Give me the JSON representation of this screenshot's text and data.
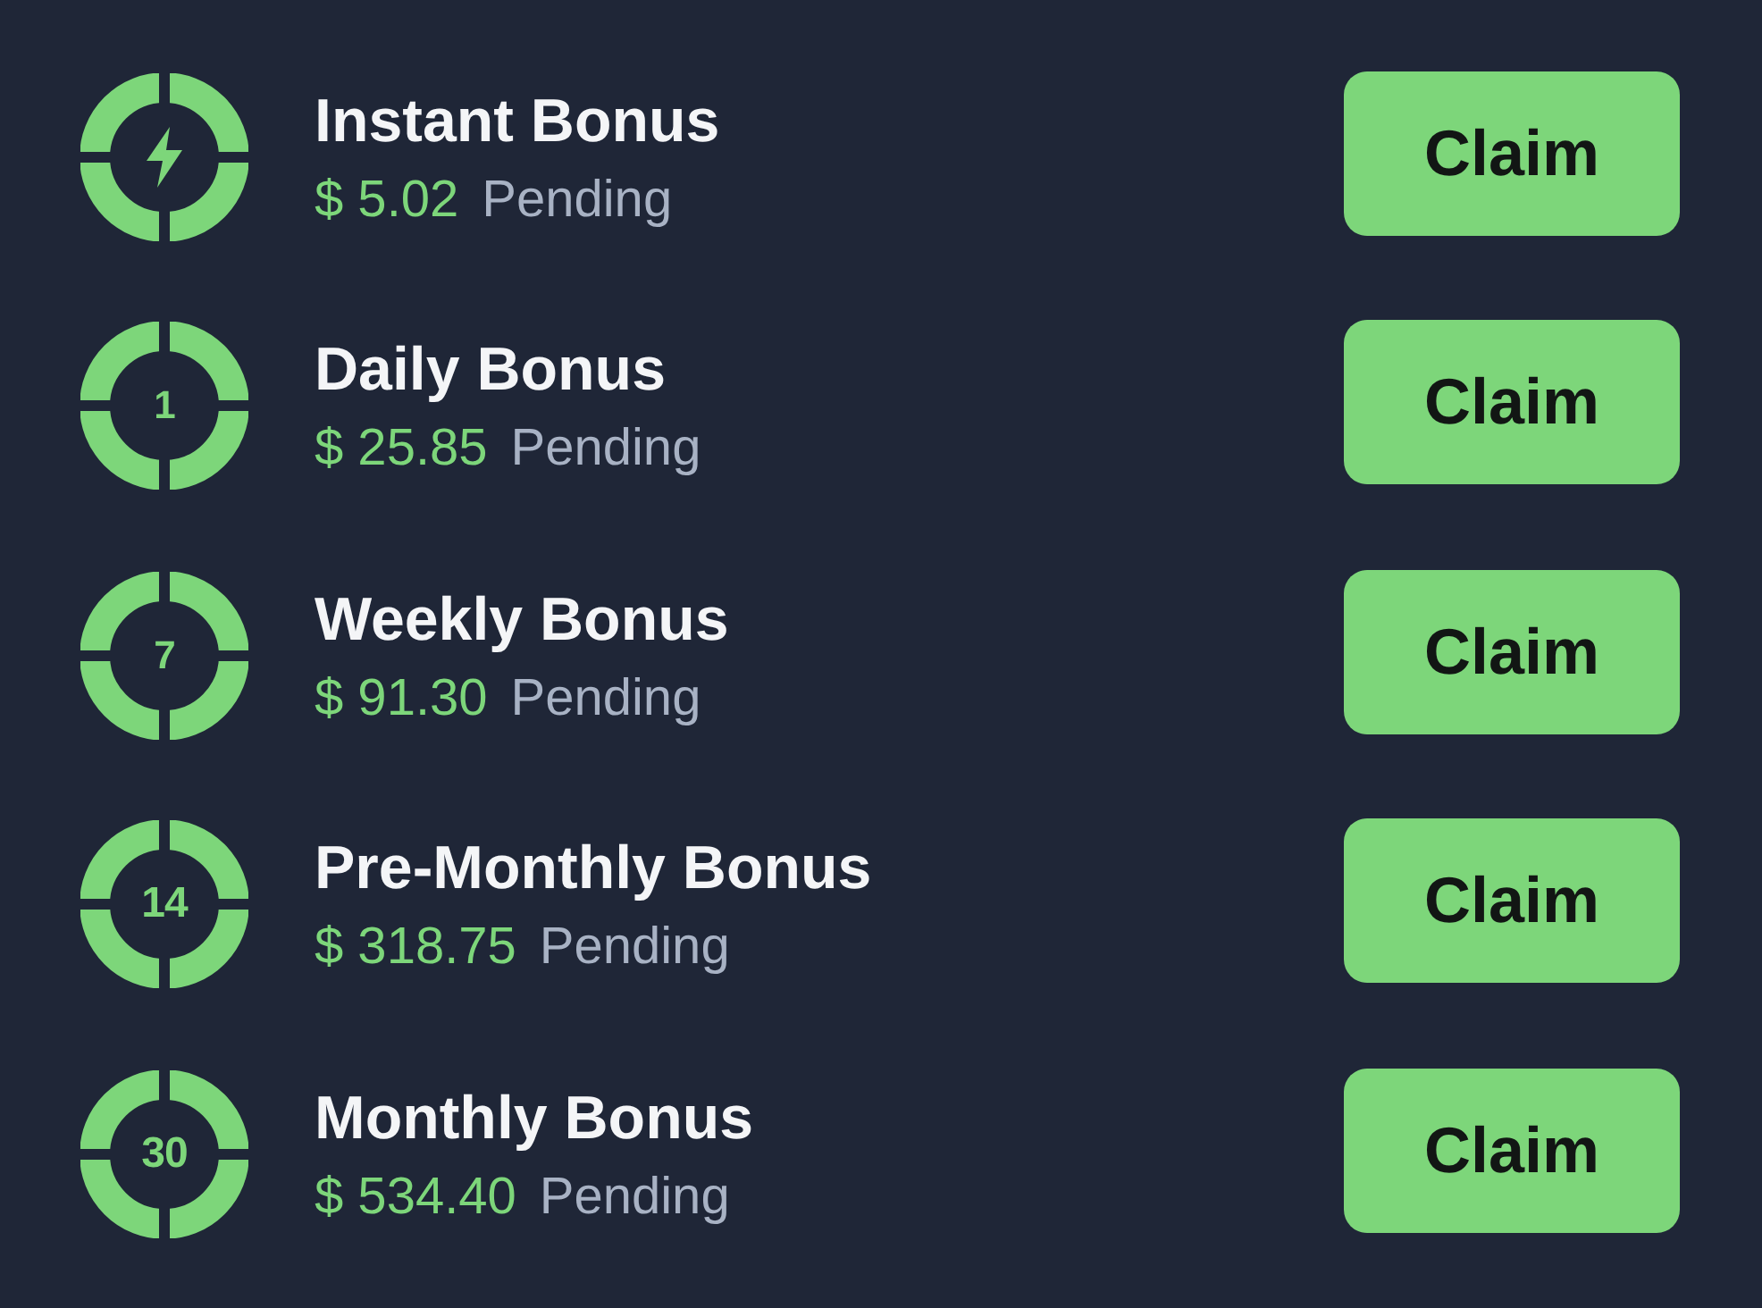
{
  "bonuses": [
    {
      "icon": {
        "kind": "bolt"
      },
      "title": "Instant Bonus",
      "amount": "$ 5.02",
      "status": "Pending",
      "button": "Claim"
    },
    {
      "icon": {
        "kind": "number",
        "label": "1"
      },
      "title": "Daily Bonus",
      "amount": "$ 25.85",
      "status": "Pending",
      "button": "Claim"
    },
    {
      "icon": {
        "kind": "number",
        "label": "7"
      },
      "title": "Weekly Bonus",
      "amount": "$ 91.30",
      "status": "Pending",
      "button": "Claim"
    },
    {
      "icon": {
        "kind": "number",
        "label": "14"
      },
      "title": "Pre-Monthly Bonus",
      "amount": "$ 318.75",
      "status": "Pending",
      "button": "Claim"
    },
    {
      "icon": {
        "kind": "number",
        "label": "30"
      },
      "title": "Monthly Bonus",
      "amount": "$ 534.40",
      "status": "Pending",
      "button": "Claim"
    }
  ]
}
